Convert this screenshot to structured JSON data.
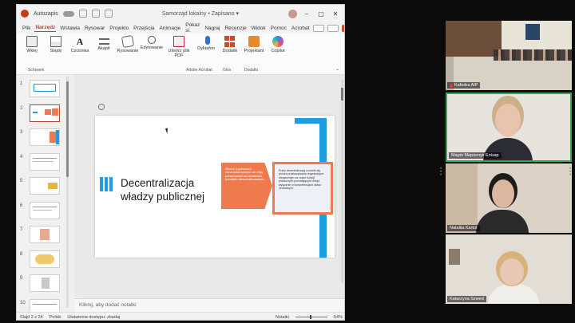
{
  "app": {
    "autosave_label": "Autozapis",
    "window_title": "Samorząd lokalny • Zapisano ▾"
  },
  "menu": {
    "tabs": [
      "Plik",
      "Narzędz",
      "Wstawia",
      "Rysowar",
      "Projekto",
      "Przejścia",
      "Animacje",
      "Pokaz sl.",
      "Nagraj",
      "Recenzje",
      "Widok",
      "Pomoc",
      "Acrobat"
    ],
    "active_index": 1
  },
  "ribbon": {
    "items": [
      {
        "label": "Wklej",
        "icon": "paste-icon"
      },
      {
        "label": "Slajdy",
        "icon": "slides-icon"
      },
      {
        "label": "Czcionka",
        "icon": "font-icon"
      },
      {
        "label": "Akapit",
        "icon": "paragraph-icon"
      },
      {
        "label": "Rysowanie",
        "icon": "drawing-icon"
      },
      {
        "label": "Edytowanie",
        "icon": "search-icon"
      },
      {
        "label": "Utwórz plik PDF",
        "icon": "pdf-icon"
      },
      {
        "label": "Dyktafon",
        "icon": "microphone-icon"
      },
      {
        "label": "Dodatki",
        "icon": "addins-icon"
      },
      {
        "label": "Projektant",
        "icon": "designer-icon"
      },
      {
        "label": "Copilot",
        "icon": "copilot-icon"
      }
    ],
    "groups": [
      "Schowek",
      "Adobe Acrobat",
      "Głos",
      "Dodatki"
    ]
  },
  "thumbnails": {
    "numbers": [
      "1",
      "2",
      "3",
      "4",
      "5",
      "6",
      "7",
      "8",
      "9",
      "10"
    ],
    "selected_index": 1
  },
  "slide": {
    "title": "Decentralizacja władzy publicznej",
    "box_left_text": "Władze w państwach zdecentralizowanych nie mają pełnej kontroli nad działaniem jednostek zdecentralizowanych...",
    "box_right_text": "Przez decentralizację rozumie się proces przekazywania organizacjom niezależnym od rządu funkcji publicznych pozostających dotąd wyłącznie w kompetencjach władz centralnych.",
    "accent_color": "#1e9ee0",
    "box_color": "#ef7a4e"
  },
  "notes": {
    "placeholder": "Kliknij, aby dodać notatki"
  },
  "status": {
    "slide_counter": "Slajd 2 z 24",
    "language": "Polski",
    "accessibility": "Ułatwienia dostępu: zbadaj",
    "notes_label": "Notatki",
    "zoom": "54%"
  },
  "participants": [
    {
      "name": "Kafedra AIP",
      "muted": true,
      "active": false
    },
    {
      "name": "Марія Мирончук Елізар",
      "muted": false,
      "active": true
    },
    {
      "name": "Nataliia Kartot",
      "muted": false,
      "active": false
    },
    {
      "name": "Katarzyna Szwed",
      "muted": false,
      "active": false
    }
  ]
}
